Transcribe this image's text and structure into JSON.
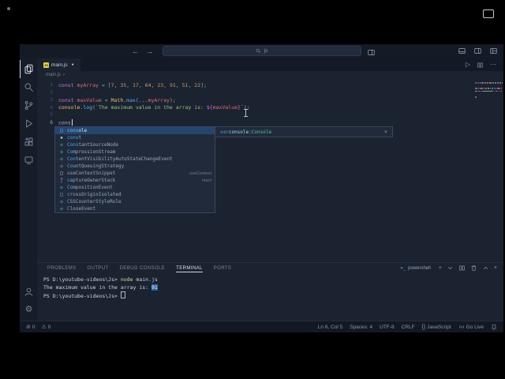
{
  "icons": {
    "back": "←",
    "forward": "→",
    "more": "⋯",
    "run": "▷",
    "close": "×",
    "plus": "+",
    "gear": "⚙",
    "warning": "⚠",
    "error": "⊘",
    "braces": "{}",
    "modified_dot": "●",
    "breadcrumb_chevron": "›",
    "shell": ">_"
  },
  "titlebar": {
    "command_text": "js"
  },
  "tabbar": {
    "tab": {
      "badge": "JS",
      "label": "main.js"
    },
    "actions": [
      {
        "name": "run-code",
        "icon": "run"
      },
      {
        "name": "split-editor",
        "icon": "split"
      },
      {
        "name": "more-actions",
        "icon": "more"
      }
    ]
  },
  "breadcrumb": {
    "file": "main.js"
  },
  "activity_bar": {
    "top": [
      {
        "name": "explorer",
        "icon": "files",
        "active": true
      },
      {
        "name": "search",
        "icon": "search"
      },
      {
        "name": "source-control",
        "icon": "git"
      },
      {
        "name": "run-debug",
        "icon": "debug"
      },
      {
        "name": "extensions",
        "icon": "extensions"
      },
      {
        "name": "remote-explorer",
        "icon": "remote"
      }
    ],
    "bottom": [
      {
        "name": "account",
        "icon": "account"
      },
      {
        "name": "settings",
        "icon": "gear"
      }
    ]
  },
  "editor": {
    "lines": [
      {
        "num": "1",
        "segments": [
          {
            "t": "const",
            "c": "kw"
          },
          {
            "t": " ",
            "c": "plain"
          },
          {
            "t": "myArray",
            "c": "var"
          },
          {
            "t": " ",
            "c": "plain"
          },
          {
            "t": "=",
            "c": "op"
          },
          {
            "t": " ",
            "c": "plain"
          },
          {
            "t": "[",
            "c": "punc"
          },
          {
            "t": "7",
            "c": "num"
          },
          {
            "t": ", ",
            "c": "punc"
          },
          {
            "t": "35",
            "c": "num"
          },
          {
            "t": ", ",
            "c": "punc"
          },
          {
            "t": "17",
            "c": "num"
          },
          {
            "t": ", ",
            "c": "punc"
          },
          {
            "t": "64",
            "c": "num"
          },
          {
            "t": ", ",
            "c": "punc"
          },
          {
            "t": "23",
            "c": "num"
          },
          {
            "t": ", ",
            "c": "punc"
          },
          {
            "t": "91",
            "c": "num"
          },
          {
            "t": ", ",
            "c": "punc"
          },
          {
            "t": "51",
            "c": "num"
          },
          {
            "t": ", ",
            "c": "punc"
          },
          {
            "t": "22",
            "c": "num"
          },
          {
            "t": "];",
            "c": "punc"
          }
        ]
      },
      {
        "num": "2",
        "segments": []
      },
      {
        "num": "3",
        "segments": [
          {
            "t": "const",
            "c": "kw"
          },
          {
            "t": " ",
            "c": "plain"
          },
          {
            "t": "maxValue",
            "c": "var"
          },
          {
            "t": " ",
            "c": "plain"
          },
          {
            "t": "=",
            "c": "op"
          },
          {
            "t": " ",
            "c": "plain"
          },
          {
            "t": "Math",
            "c": "obj"
          },
          {
            "t": ".",
            "c": "punc"
          },
          {
            "t": "max",
            "c": "fn"
          },
          {
            "t": "(",
            "c": "punc"
          },
          {
            "t": "...",
            "c": "op"
          },
          {
            "t": "myArray",
            "c": "var"
          },
          {
            "t": ");",
            "c": "punc"
          }
        ]
      },
      {
        "num": "4",
        "segments": [
          {
            "t": "console",
            "c": "obj"
          },
          {
            "t": ".",
            "c": "punc"
          },
          {
            "t": "log",
            "c": "fn"
          },
          {
            "t": "(",
            "c": "punc"
          },
          {
            "t": "`The maximum value in the array is: ",
            "c": "str"
          },
          {
            "t": "${",
            "c": "interp"
          },
          {
            "t": "maxValue",
            "c": "var"
          },
          {
            "t": "}",
            "c": "interp"
          },
          {
            "t": "`",
            "c": "str"
          },
          {
            "t": ");",
            "c": "punc"
          }
        ]
      },
      {
        "num": "5",
        "segments": []
      },
      {
        "num": "6",
        "active": true,
        "cursor": true,
        "segments": [
          {
            "t": "cons",
            "c": "plain"
          }
        ]
      }
    ]
  },
  "suggest": {
    "selected_index": 0,
    "glyphs": {
      "var": "□",
      "keyword": "▪",
      "class": "◇",
      "snippet": "□",
      "function": "ƒ"
    },
    "items": [
      {
        "type": "var",
        "match": "cons",
        "rest": "ole",
        "detail": ""
      },
      {
        "type": "keyword",
        "match": "cons",
        "rest": "t",
        "detail": ""
      },
      {
        "type": "class",
        "match": "Cons",
        "rest": "tantSourceNode",
        "detail": ""
      },
      {
        "type": "class",
        "match": "Co",
        "rest": "mpressionStream",
        "detail": ""
      },
      {
        "type": "class",
        "match": "Con",
        "rest": "tentVisibilityAutoStateChangeEvent",
        "detail": ""
      },
      {
        "type": "class",
        "match": "Co",
        "rest": "untQueuingStrategy",
        "detail": ""
      },
      {
        "type": "snippet",
        "match": "",
        "rest": "useContextSnippet",
        "detail": "useContext"
      },
      {
        "type": "function",
        "match": "c",
        "rest": "aptureOwnerStack",
        "detail": "react"
      },
      {
        "type": "class",
        "match": "Co",
        "rest": "mpositionEvent",
        "detail": ""
      },
      {
        "type": "var",
        "match": "c",
        "rest": "rossOriginIsolated",
        "detail": ""
      },
      {
        "type": "class",
        "match": "C",
        "rest": "SSCounterStyleRule",
        "detail": ""
      },
      {
        "type": "class",
        "match": "C",
        "rest": "loseEvent",
        "detail": ""
      }
    ],
    "doc": {
      "segments": [
        {
          "t": "var ",
          "c": "d-kw"
        },
        {
          "t": "console",
          "c": "d-id"
        },
        {
          "t": ": ",
          "c": "d-plain"
        },
        {
          "t": "Console",
          "c": "d-type"
        }
      ]
    }
  },
  "panel": {
    "tabs": [
      {
        "label": "PROBLEMS"
      },
      {
        "label": "OUTPUT"
      },
      {
        "label": "DEBUG CONSOLE"
      },
      {
        "label": "TERMINAL",
        "active": true
      },
      {
        "label": "PORTS"
      }
    ],
    "shell_label": "powershell",
    "actions": [
      {
        "name": "new-terminal",
        "icon": "plus"
      },
      {
        "name": "launch-profile",
        "icon": "chevdown"
      },
      {
        "name": "split-terminal",
        "icon": "split"
      },
      {
        "name": "kill-terminal",
        "icon": "trash"
      },
      {
        "name": "maximize-panel",
        "icon": "chevup"
      },
      {
        "name": "close-panel",
        "icon": "close"
      }
    ],
    "terminal_lines": [
      [
        {
          "t": "PS D:\\youtube-videos\\Js> ",
          "c": "t-prompt"
        },
        {
          "t": "node",
          "c": "t-cmd"
        },
        {
          "t": " main.js",
          "c": "t-arg"
        }
      ],
      [
        {
          "t": "The maximum value in the array is: ",
          "c": "t-out"
        },
        {
          "t": "91",
          "c": "t-sel"
        }
      ],
      [
        {
          "t": "PS D:\\youtube-videos\\Js> ",
          "c": "t-prompt"
        },
        {
          "t": "",
          "c": "t-cursor"
        }
      ]
    ]
  },
  "status_bar": {
    "left": [
      {
        "name": "errors",
        "icon": "error",
        "label": "0"
      },
      {
        "name": "warnings",
        "icon": "warning",
        "label": "0"
      }
    ],
    "right": [
      {
        "name": "cursor-position",
        "label": "Ln 6, Col 5"
      },
      {
        "name": "indentation",
        "label": "Spaces: 4"
      },
      {
        "name": "encoding",
        "label": "UTF-8"
      },
      {
        "name": "eol",
        "label": "CRLF"
      },
      {
        "name": "language-mode",
        "icon": "braces",
        "label": "JavaScript"
      },
      {
        "name": "go-live",
        "icon": "broadcast",
        "label": "Go Live"
      },
      {
        "name": "notifications",
        "icon": "bell",
        "label": ""
      }
    ]
  }
}
